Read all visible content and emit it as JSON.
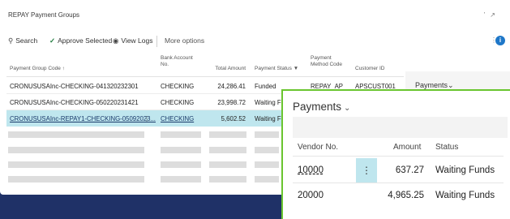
{
  "window": {
    "title": "REPAY Payment Groups"
  },
  "actions": {
    "search": "Search",
    "approve": "Approve Selected",
    "view_logs": "View Logs",
    "more": "More options"
  },
  "columns": {
    "code": "Payment Group Code ↑",
    "bank_line1": "Bank Account",
    "bank_line2": "No.",
    "amount": "Total Amount",
    "status": "Payment Status",
    "method_line1": "Payment",
    "method_line2": "Method Code",
    "customer": "Customer ID"
  },
  "rows": [
    {
      "code": "CRONUSUSAInc-CHECKING-041320232301",
      "bank": "CHECKING",
      "amount": "24,286.41",
      "status": "Funded",
      "method": "REPAY_AP",
      "customer": "APSCUST001"
    },
    {
      "code": "CRONUSUSAInc-CHECKING-050220231421",
      "bank": "CHECKING",
      "amount": "23,998.72",
      "status": "Waiting F",
      "method": "",
      "customer": ""
    },
    {
      "code": "CRONUSUSAInc-REPAY1-CHECKING-05092023...",
      "bank": "CHECKING",
      "amount": "5,602.52",
      "status": "Waiting Fu",
      "method": "",
      "customer": ""
    }
  ],
  "factbox": {
    "title": "Payments"
  },
  "payments_zoom": {
    "title": "Payments",
    "headers": {
      "vendor": "Vendor No.",
      "amount": "Amount",
      "status": "Status"
    },
    "rows": [
      {
        "vendor": "10000",
        "amount": "637.27",
        "status": "Waiting Funds"
      },
      {
        "vendor": "20000",
        "amount": "4,965.25",
        "status": "Waiting Funds"
      }
    ]
  },
  "colors": {
    "background": "#1f3167",
    "selected_row": "#bfe6ee",
    "highlight_border": "#6ac52f",
    "info": "#1e77c8"
  }
}
